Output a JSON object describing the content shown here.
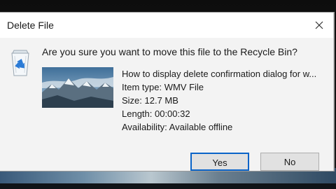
{
  "window": {
    "title": "Delete File"
  },
  "dialog": {
    "question": "Are you sure you want to move this file to the Recycle Bin?",
    "file": {
      "name": "How to display delete confirmation dialog for w...",
      "item_type": "Item type: WMV File",
      "size": "Size: 12.7 MB",
      "length": "Length: 00:00:32",
      "availability": "Availability: Available offline"
    }
  },
  "buttons": {
    "yes_label": "Yes",
    "no_label": "No"
  },
  "icons": {
    "close": "close-icon",
    "recycle_bin": "recycle-bin-icon",
    "thumbnail": "video-thumbnail"
  },
  "colors": {
    "accent": "#0a64c8",
    "button_bg": "#e1e1e1",
    "dialog_body": "#f3f3f3"
  }
}
